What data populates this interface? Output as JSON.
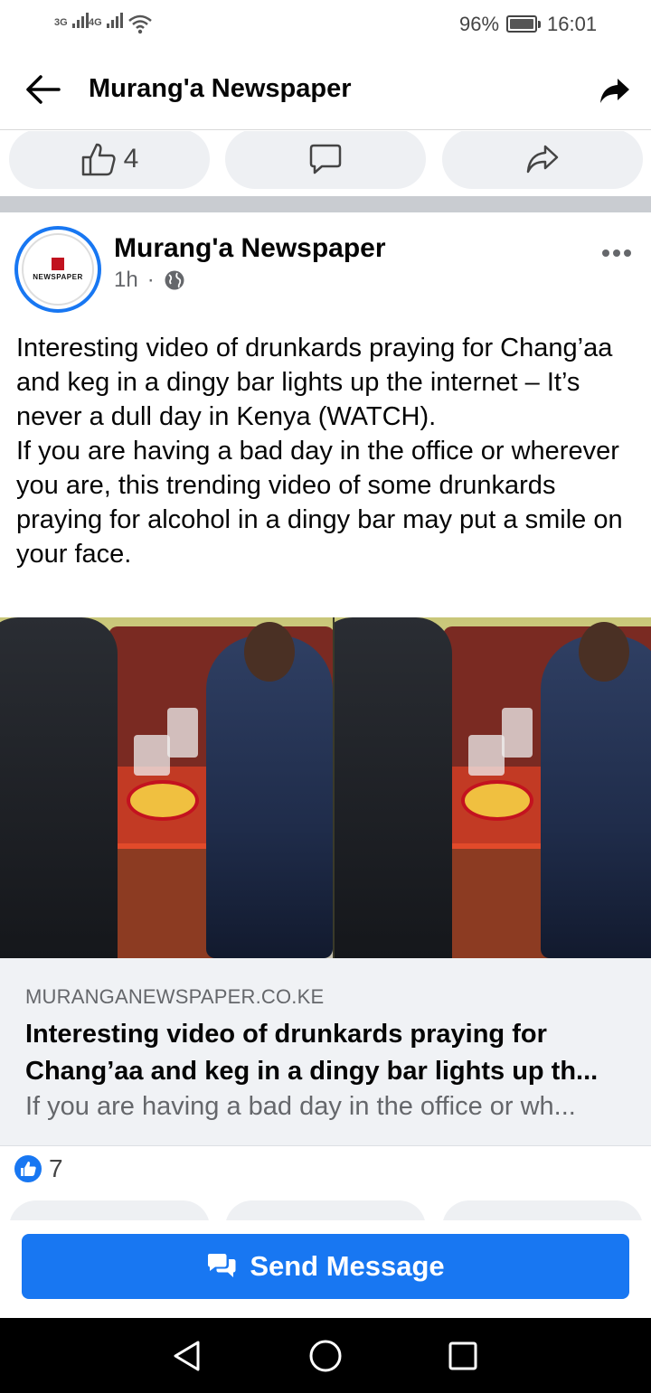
{
  "status_bar": {
    "signal_1": "3G",
    "signal_2": "4G",
    "battery": "96%",
    "time": "16:01"
  },
  "header": {
    "title": "Murang'a Newspaper",
    "back_icon": "arrow-left-icon",
    "share_icon": "share-arrow-icon"
  },
  "previous_post": {
    "like_count": "4"
  },
  "post": {
    "author": "Murang'a Newspaper",
    "time": "1h",
    "separator": "·",
    "avatar_text": "NEWSPAPER",
    "body": [
      "Interesting video of drunkards praying for Chang’aa and keg in a dingy bar lights up the internet – It’s never a dull day in Kenya (WATCH).",
      "If you are having a bad day in the office or wherever you are, this trending video of some drunkards praying for alcohol in a dingy bar may put a smile on your face."
    ],
    "link_preview": {
      "domain": "MURANGANEWSPAPER.CO.KE",
      "title_line_1": "Interesting video of drunkards praying for",
      "title_line_2": "Chang’aa and keg in a dingy bar lights up th...",
      "description": "If you are having a bad day in the office or wh..."
    },
    "reaction_count": "7"
  },
  "send_message": {
    "label": "Send Message"
  },
  "colors": {
    "brand_blue": "#1877f2",
    "pill_bg": "#eef0f3",
    "separator": "#c9ccd1"
  }
}
